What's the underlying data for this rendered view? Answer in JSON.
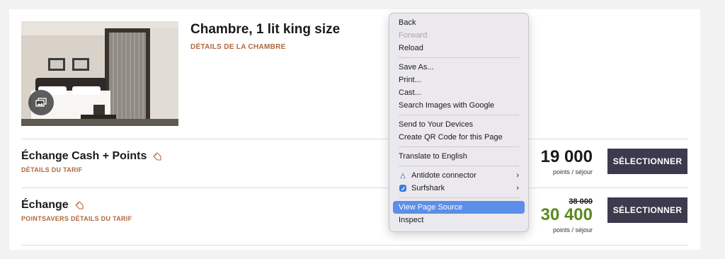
{
  "room": {
    "title": "Chambre, 1 lit king size",
    "details_link": "DÉTAILS DE LA CHAMBRE"
  },
  "rates": [
    {
      "title": "Échange Cash + Points",
      "details_link": "DÉTAILS DU TARIF",
      "price": "19 000",
      "unit": "points / séjour",
      "button": "SÉLECTIONNER"
    },
    {
      "title": "Échange",
      "details_link": "POINTSAVERS DÉTAILS DU TARIF",
      "old_price": "38 000",
      "price": "30 400",
      "unit": "points / séjour",
      "button": "SÉLECTIONNER"
    }
  ],
  "context_menu": {
    "items": [
      {
        "label": "Back"
      },
      {
        "label": "Forward",
        "disabled": true
      },
      {
        "label": "Reload"
      },
      {
        "label": "Save As..."
      },
      {
        "label": "Print..."
      },
      {
        "label": "Cast..."
      },
      {
        "label": "Search Images with Google"
      },
      {
        "label": "Send to Your Devices"
      },
      {
        "label": "Create QR Code for this Page"
      },
      {
        "label": "Translate to English"
      },
      {
        "label": "Antidote connector",
        "icon": "antidote-icon",
        "submenu": true
      },
      {
        "label": "Surfshark",
        "icon": "surfshark-icon",
        "submenu": true
      },
      {
        "label": "View Page Source",
        "highlighted": true
      },
      {
        "label": "Inspect"
      }
    ],
    "submenu_arrow": "›"
  },
  "colors": {
    "accent_link": "#b0673c",
    "button_bg": "#3d3a4e",
    "price_discount": "#5a8a1f",
    "menu_highlight": "#5b8ee8"
  }
}
